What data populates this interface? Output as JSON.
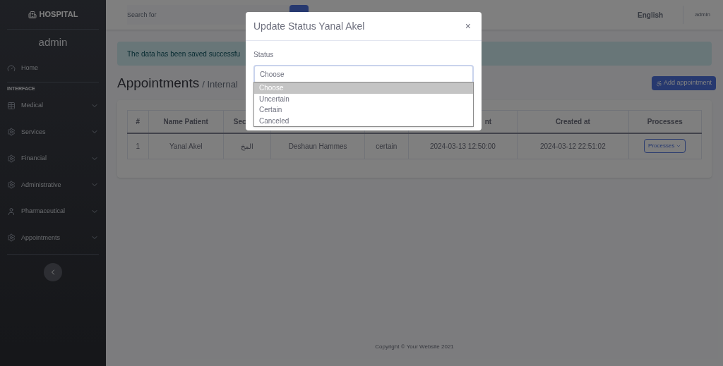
{
  "sidebar": {
    "brand": "HOSPITAL",
    "user": "admin",
    "section_heading": "INTERFACE",
    "items": [
      {
        "label": "Home",
        "kind": "link"
      },
      {
        "label": "Medical",
        "kind": "dropdown",
        "expanded": false
      },
      {
        "label": "Services",
        "kind": "dropdown",
        "expanded": false
      },
      {
        "label": "Financial",
        "kind": "dropdown",
        "expanded": false
      },
      {
        "label": "Administrative",
        "kind": "dropdown",
        "expanded": false
      },
      {
        "label": "Pharmaceutical",
        "kind": "dropdown",
        "expanded": false
      },
      {
        "label": "Appointments",
        "kind": "dropdown",
        "expanded": false
      }
    ]
  },
  "topbar": {
    "search_placeholder": "Search for",
    "language": "English",
    "user": "admin"
  },
  "alert": "The data has been saved successfu",
  "page": {
    "title": "Appointments",
    "subtitle": "/ Internal",
    "add_button": "Add appointment"
  },
  "table": {
    "columns": [
      "#",
      "Name Patient",
      "Sec",
      "",
      "",
      "nt",
      "Created at",
      "Processes"
    ],
    "rows": [
      {
        "cells": [
          "1",
          "Yanal Akel",
          "المخ",
          "Deshaun Hammes",
          "certain",
          "2024-03-13 12:50:00",
          "2024-03-12 22:51:02"
        ],
        "action": "Processes"
      }
    ]
  },
  "footer": "Copyright © Your Website 2021",
  "modal": {
    "title": "Update Status Yanal Akel",
    "close": "×",
    "field_label": "Status",
    "value": "Choose",
    "options": [
      {
        "label": "Choose",
        "selected": true
      },
      {
        "label": "Uncertain",
        "selected": false
      },
      {
        "label": "Certain",
        "selected": false
      },
      {
        "label": "Canceled",
        "selected": false
      }
    ]
  }
}
